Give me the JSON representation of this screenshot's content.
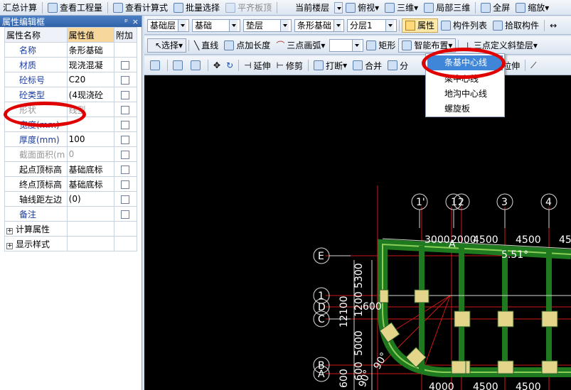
{
  "top_toolbar": {
    "items": [
      "汇总计算",
      "查看工程量",
      "查看计算式",
      "批量选择",
      "平齐板顶"
    ],
    "floor_label": "当前楼层",
    "view_items": [
      "俯视",
      "三维",
      "局部三维",
      "全屏",
      "缩放"
    ]
  },
  "panel": {
    "title": "属性编辑框",
    "pin_label": "ᵖ",
    "close_label": "×",
    "headers": {
      "name": "属性名称",
      "value": "属性值",
      "extra": "附加"
    },
    "rows": [
      {
        "name": "名称",
        "value": "条形基础",
        "checkbox": false,
        "style": "blue"
      },
      {
        "name": "材质",
        "value": "现浇混凝",
        "checkbox": true,
        "style": "blue"
      },
      {
        "name": "砼标号",
        "value": "C20",
        "checkbox": true,
        "style": "blue"
      },
      {
        "name": "砼类型",
        "value": "(4现浇砼",
        "checkbox": true,
        "style": "blue"
      },
      {
        "name": "形状",
        "value": "线型",
        "checkbox": true,
        "style": "grey"
      },
      {
        "name": "宽度(mm)",
        "value": "",
        "checkbox": true,
        "style": "blue"
      },
      {
        "name": "厚度(mm)",
        "value": "100",
        "checkbox": true,
        "style": "blue"
      },
      {
        "name": "截面面积(m",
        "value": "0",
        "checkbox": true,
        "style": "grey"
      },
      {
        "name": "起点顶标高",
        "value": "基础底标",
        "checkbox": true,
        "style": "normal"
      },
      {
        "name": "终点顶标高",
        "value": "基础底标",
        "checkbox": true,
        "style": "normal"
      },
      {
        "name": "轴线距左边",
        "value": "(0)",
        "checkbox": true,
        "style": "normal"
      },
      {
        "name": "备注",
        "value": "",
        "checkbox": true,
        "style": "blue"
      }
    ],
    "groups": [
      "计算属性",
      "显示样式"
    ]
  },
  "row1": {
    "layer1": "基础层",
    "layer2": "基础",
    "type": "垫层",
    "component": "条形基础",
    "sublayer": "分层1",
    "properties_label": "属性",
    "list_label": "构件列表",
    "pick_label": "拾取构件",
    "more": "↔"
  },
  "row2": {
    "select_label": "选择",
    "line_label": "直线",
    "extend_label": "点加长度",
    "arc_label": "三点画弧",
    "rect_label": "矩形",
    "smart_label": "智能布置",
    "slope_label": "三点定义斜垫层"
  },
  "row3": {
    "extend_label": "延伸",
    "trim_label": "修剪",
    "break_label": "打断",
    "merge_label": "合并",
    "split_label": "分",
    "move_label": "移",
    "stretch_label": "拉伸"
  },
  "menu": {
    "items": [
      "条基中心线",
      "梁中心线",
      "地沟中心线",
      "螺旋板"
    ],
    "selected": "条基中心线"
  },
  "drawing": {
    "axis_top": [
      "1'",
      "1",
      "2",
      "3",
      "4"
    ],
    "axis_left": [
      "E",
      "1",
      "D",
      "C",
      "B",
      "A"
    ],
    "dims_top": [
      "3000",
      "2000",
      "4500",
      "4500",
      "45"
    ],
    "dims_bottom": [
      "4000",
      "4500",
      "4500"
    ],
    "angle_label": "5.51°",
    "angle_90a": "90°",
    "angle_90b": "90°",
    "axis_a_label": "A",
    "vert_dims": [
      "5300",
      "1200",
      "12100",
      "5000",
      "600",
      "600",
      "600"
    ]
  }
}
